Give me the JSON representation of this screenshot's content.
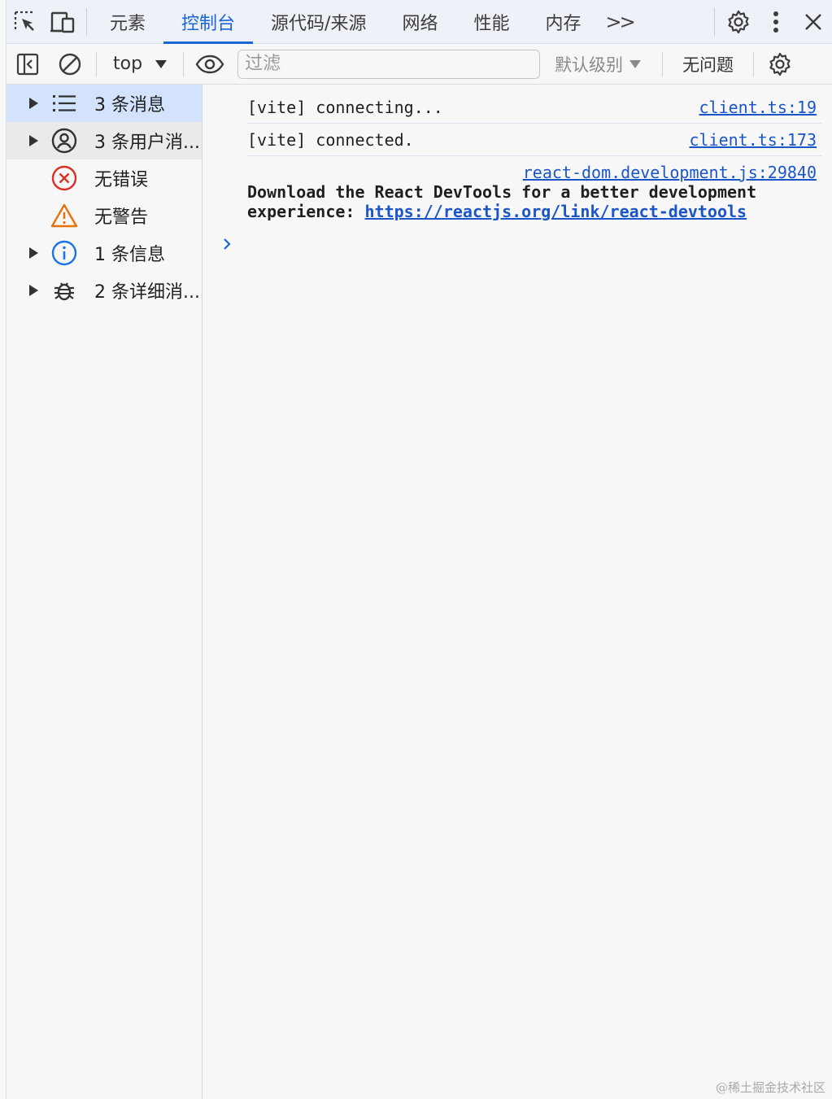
{
  "tabbar": {
    "tabs": [
      {
        "label": "元素"
      },
      {
        "label": "控制台",
        "active": true
      },
      {
        "label": "源代码/来源"
      },
      {
        "label": "网络"
      },
      {
        "label": "性能"
      },
      {
        "label": "内存"
      }
    ],
    "more_label": ">>",
    "accent_color": "#1a66d6"
  },
  "toolbar": {
    "context": "top",
    "filter_placeholder": "过滤",
    "filter_value": "",
    "levels_label": "默认级别",
    "issues_label": "无问题"
  },
  "sidebar": {
    "items": [
      {
        "label": "3 条消息",
        "icon": "list-icon",
        "expandable": true,
        "selected": true
      },
      {
        "label": "3 条用户消...",
        "icon": "user-circle-icon",
        "expandable": true
      },
      {
        "label": "无错误",
        "icon": "error-icon",
        "expandable": false,
        "color": "#d93025"
      },
      {
        "label": "无警告",
        "icon": "warning-icon",
        "expandable": false,
        "color": "#e8710a"
      },
      {
        "label": "1 条信息",
        "icon": "info-icon",
        "expandable": true,
        "color": "#1a73e8"
      },
      {
        "label": "2 条详细消...",
        "icon": "bug-icon",
        "expandable": true
      }
    ]
  },
  "console": {
    "messages": [
      {
        "text": "[vite] connecting...",
        "source": "client.ts:19"
      },
      {
        "text": "[vite] connected.",
        "source": "client.ts:173"
      },
      {
        "source": "react-dom.development.js:29840",
        "line1": "Download the React DevTools for a better development",
        "line2_prefix": "experience: ",
        "link": "https://reactjs.org/link/react-devtools"
      }
    ]
  },
  "watermark": "@稀土掘金技术社区"
}
